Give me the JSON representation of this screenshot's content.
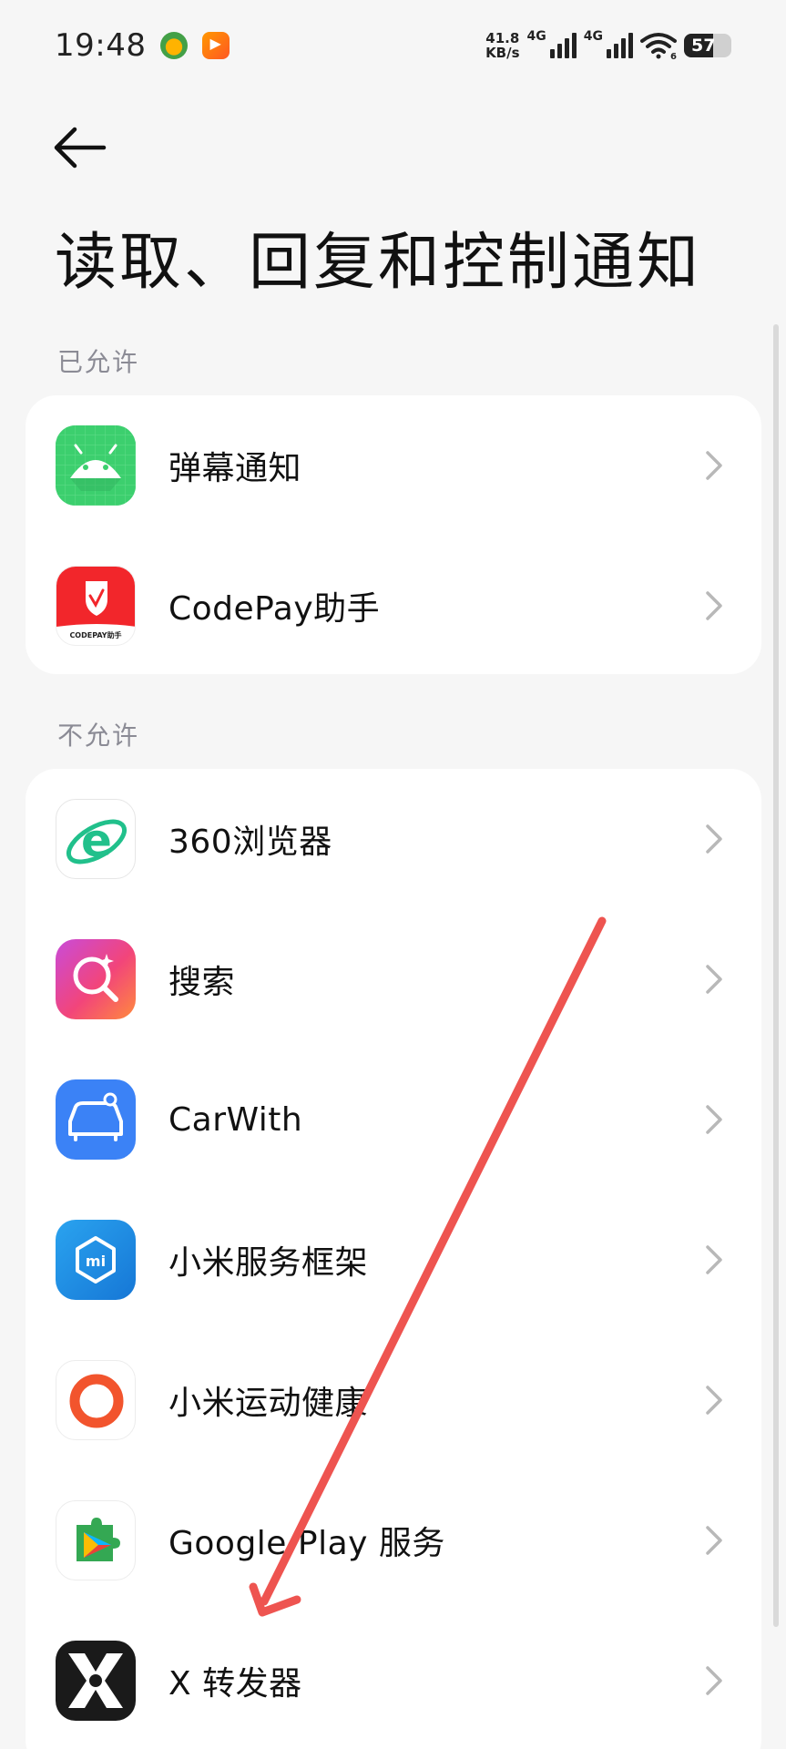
{
  "status_bar": {
    "time": "19:48",
    "net_speed_value": "41.8",
    "net_speed_unit": "KB/s",
    "signal1_label": "4G",
    "signal2_label": "4G",
    "wifi_sub": "6",
    "battery": "57"
  },
  "header": {
    "title": "读取、回复和控制通知"
  },
  "sections": {
    "allowed": {
      "label": "已允许",
      "items": [
        {
          "label": "弹幕通知",
          "icon": "android-icon"
        },
        {
          "label": "CodePay助手",
          "icon": "codepay-icon",
          "icon_text": "CODEPAY助手"
        }
      ]
    },
    "not_allowed": {
      "label": "不允许",
      "items": [
        {
          "label": "360浏览器",
          "icon": "browser-360-icon"
        },
        {
          "label": "搜索",
          "icon": "search-app-icon"
        },
        {
          "label": "CarWith",
          "icon": "carwith-icon"
        },
        {
          "label": "小米服务框架",
          "icon": "mi-service-icon",
          "icon_text": "mi"
        },
        {
          "label": "小米运动健康",
          "icon": "mi-fitness-icon"
        },
        {
          "label": "Google Play 服务",
          "icon": "google-play-services-icon"
        },
        {
          "label": "X 转发器",
          "icon": "x-forwarder-icon"
        }
      ]
    }
  },
  "colors": {
    "background": "#f6f6f6",
    "card": "#ffffff",
    "section_label": "#8b8b95",
    "arrow": "#ee5450"
  }
}
